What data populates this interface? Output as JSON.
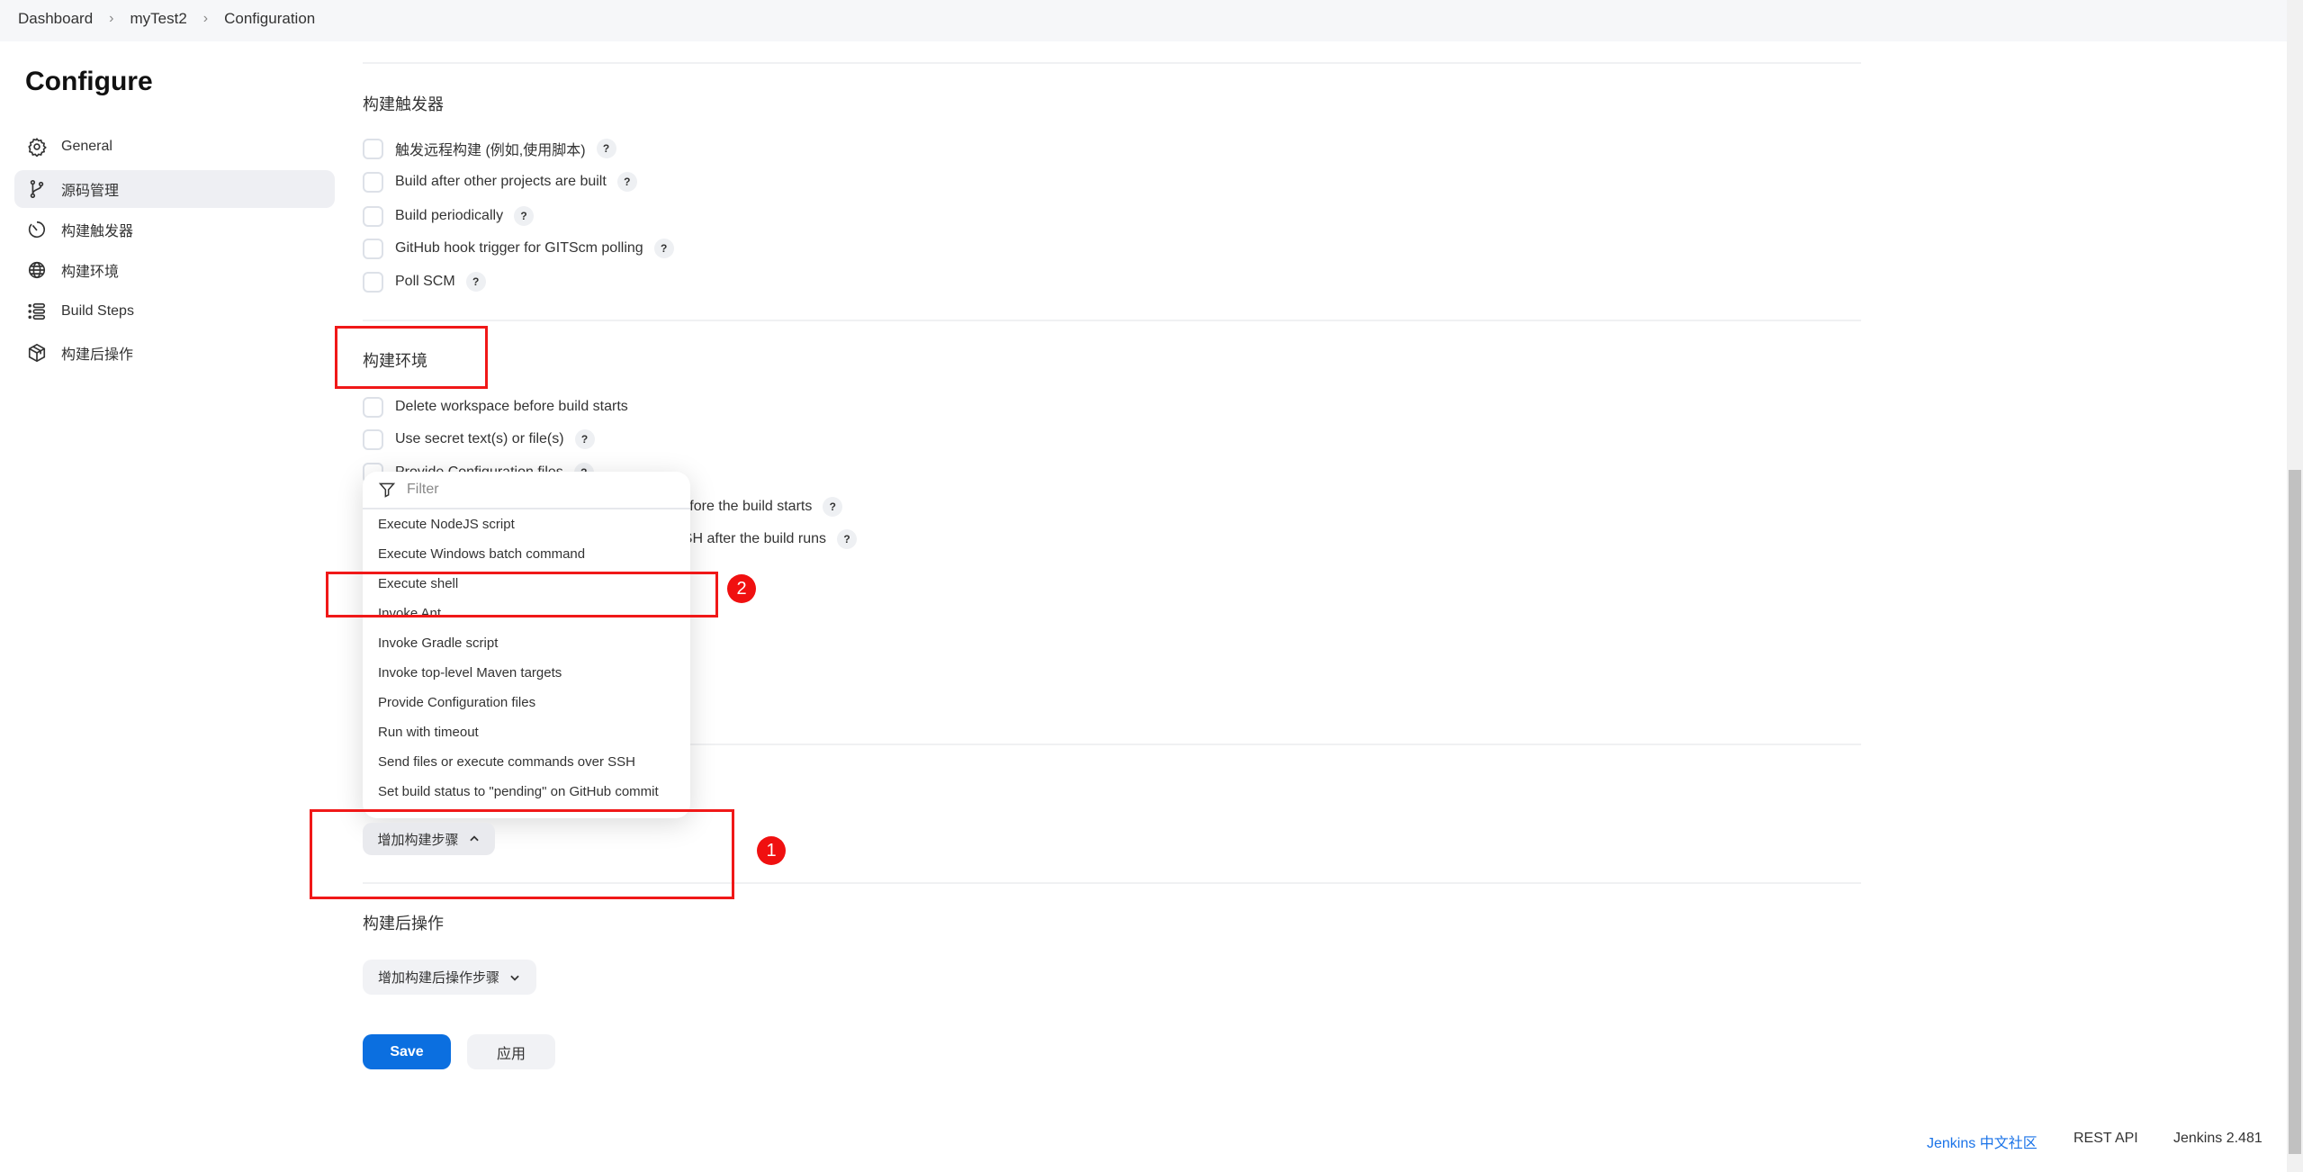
{
  "breadcrumb": [
    "Dashboard",
    "myTest2",
    "Configuration"
  ],
  "page_title": "Configure",
  "sidebar": {
    "items": [
      {
        "label": "General",
        "icon": "gear-icon"
      },
      {
        "label": "源码管理",
        "icon": "branch-icon",
        "active": true
      },
      {
        "label": "构建触发器",
        "icon": "timer-icon"
      },
      {
        "label": "构建环境",
        "icon": "globe-icon"
      },
      {
        "label": "Build Steps",
        "icon": "list-icon"
      },
      {
        "label": "构建后操作",
        "icon": "package-icon"
      }
    ]
  },
  "triggers": {
    "heading": "构建触发器",
    "options": [
      {
        "label": "触发远程构建 (例如,使用脚本)",
        "help": "?"
      },
      {
        "label": "Build after other projects are built",
        "help": "?"
      },
      {
        "label": "Build periodically",
        "help": "?"
      },
      {
        "label": "GitHub hook trigger for GITScm polling",
        "help": "?"
      },
      {
        "label": "Poll SCM",
        "help": "?"
      }
    ]
  },
  "environment": {
    "heading": "构建环境",
    "options": [
      {
        "label": "Delete workspace before build starts"
      },
      {
        "label": "Use secret text(s) or file(s)",
        "help": "?"
      },
      {
        "label": "Provide Configuration files",
        "help": "?"
      },
      {
        "label": "Send files or execute commands over SSH before the build starts",
        "help": "?"
      },
      {
        "label": "Send files or execute commands over SSH after the build runs",
        "help": "?"
      }
    ]
  },
  "dropdown": {
    "filter_placeholder": "Filter",
    "items": [
      "Execute NodeJS script",
      "Execute Windows batch command",
      "Execute shell",
      "Invoke Ant",
      "Invoke Gradle script",
      "Invoke top-level Maven targets",
      "Provide Configuration files",
      "Run with timeout",
      "Send files or execute commands over SSH",
      "Set build status to \"pending\" on GitHub commit"
    ]
  },
  "build_steps": {
    "add_button": "增加构建步骤"
  },
  "post_build": {
    "heading": "构建后操作",
    "add_button": "增加构建后操作步骤"
  },
  "actions": {
    "save": "Save",
    "apply": "应用"
  },
  "footer": {
    "community": "Jenkins 中文社区",
    "rest_api": "REST API",
    "version": "Jenkins 2.481"
  },
  "annotations": {
    "badge1": "1",
    "badge2": "2"
  },
  "colors": {
    "accent": "#0b6fe0",
    "annotation": "#f01818",
    "link": "#1a73e8"
  }
}
